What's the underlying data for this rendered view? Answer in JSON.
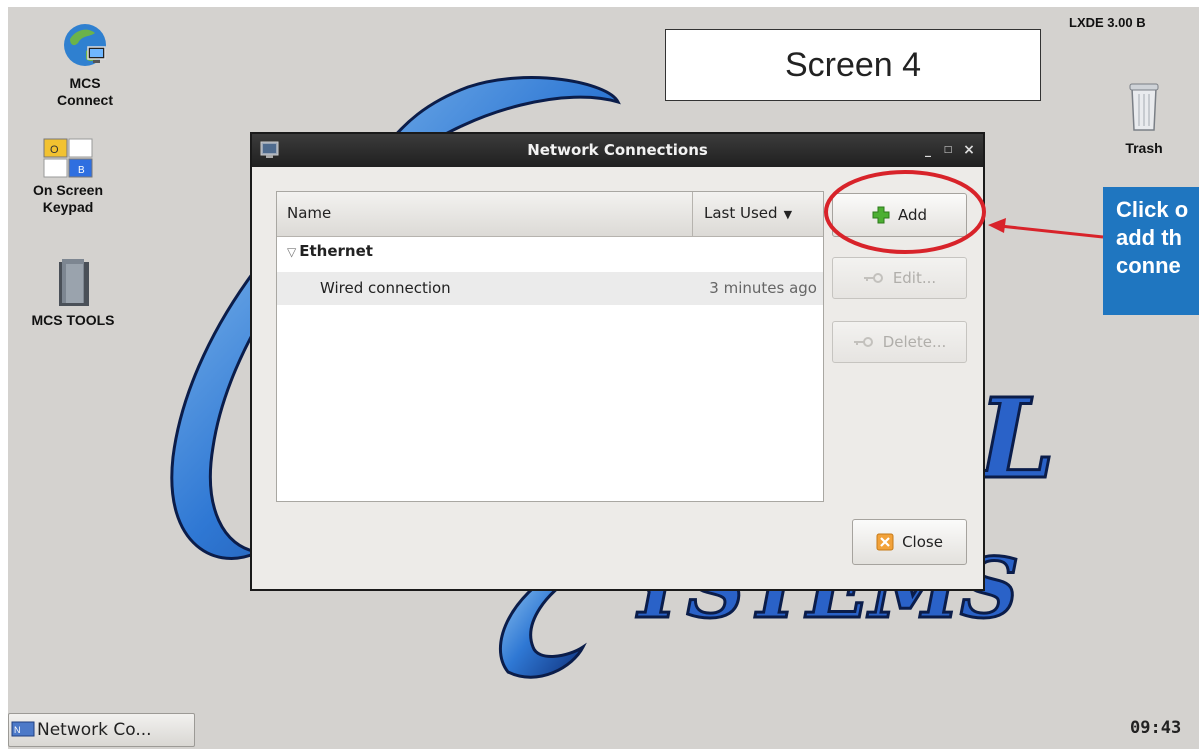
{
  "desktop": {
    "icons": [
      {
        "name": "MCS\nConnect",
        "line1": "MCS",
        "line2": "Connect",
        "icon": "globe-computer-icon"
      },
      {
        "line1": "On Screen",
        "line2": "Keypad",
        "icon": "keypad-icon",
        "keys": [
          "O",
          "",
          "",
          "B"
        ]
      },
      {
        "line1": "MCS TOOLS",
        "icon": "folder-icon"
      },
      {
        "line1": "Trash",
        "icon": "trash-icon"
      }
    ],
    "version_label": "LXDE 3.00 B",
    "wallpaper_text": [
      "L",
      "YSTEMS"
    ]
  },
  "annotation": {
    "screen_label": "Screen 4",
    "callout_lines": [
      "Click o",
      "add th",
      "conne"
    ],
    "highlight_color": "#d8232a",
    "callout_color": "#1f76c0"
  },
  "window": {
    "title": "Network Connections",
    "controls": [
      "_",
      "□",
      "×"
    ],
    "columns": {
      "name": "Name",
      "last_used": "Last Used"
    },
    "groups": [
      {
        "label": "Ethernet",
        "connections": [
          {
            "name": "Wired connection",
            "last_used": "3 minutes ago"
          }
        ]
      }
    ],
    "buttons": {
      "add": "Add",
      "edit": "Edit...",
      "delete": "Delete...",
      "close": "Close"
    }
  },
  "taskbar": {
    "task_label": "Network Co...",
    "clock": "09:43"
  }
}
